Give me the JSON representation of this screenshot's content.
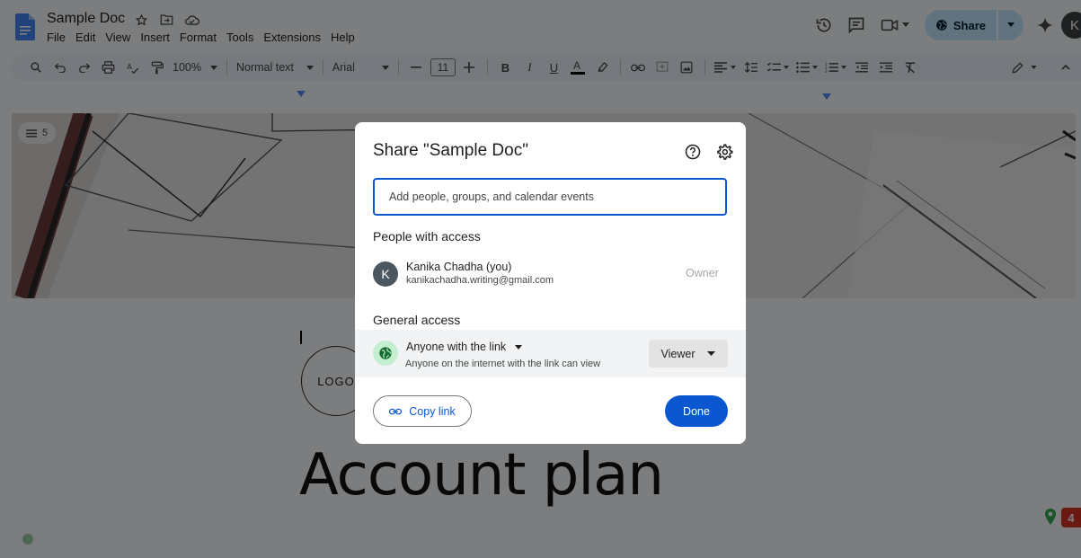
{
  "document": {
    "title": "Sample Doc",
    "menus": [
      "File",
      "Edit",
      "View",
      "Insert",
      "Format",
      "Tools",
      "Extensions",
      "Help"
    ],
    "share_label": "Share",
    "account_initial": "K"
  },
  "toolbar": {
    "zoom": "100%",
    "style": "Normal text",
    "font": "Arial",
    "font_size": "11"
  },
  "page": {
    "outline_count": "5",
    "logo_text": "LOGO",
    "heading": "Account plan",
    "corner_badge": "4"
  },
  "dialog": {
    "title": "Share \"Sample Doc\"",
    "add_placeholder": "Add people, groups, and calendar events",
    "people_section": "People with access",
    "person": {
      "initial": "K",
      "name": "Kanika Chadha (you)",
      "email": "kanikachadha.writing@gmail.com",
      "role": "Owner"
    },
    "general_section": "General access",
    "link_scope": "Anyone with the link",
    "link_description": "Anyone on the internet with the link can view",
    "link_role": "Viewer",
    "copy_link_label": "Copy link",
    "done_label": "Done"
  },
  "colors": {
    "primary": "#0b57d0",
    "share_button": "#c2e7ff",
    "general_row": "#f1f3f4",
    "globe_badge": "#c4eed0"
  }
}
